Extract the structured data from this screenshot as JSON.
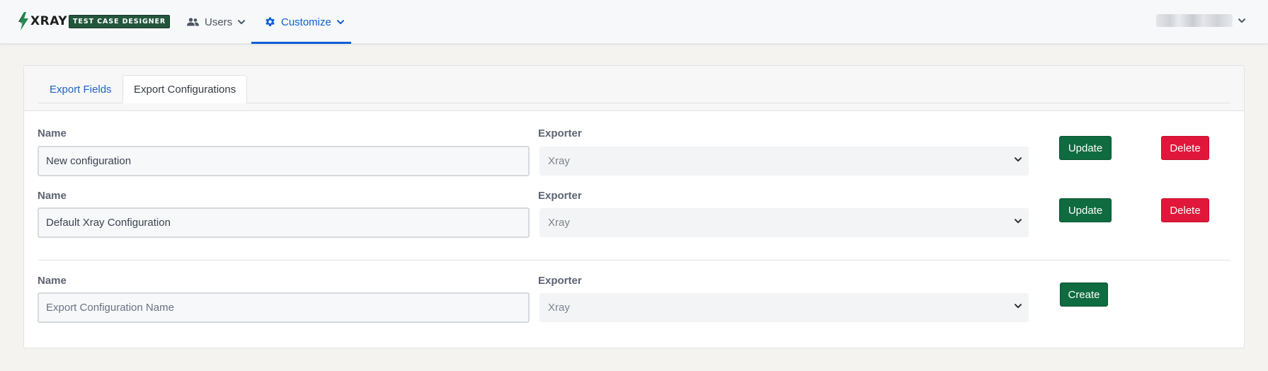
{
  "header": {
    "logo": {
      "wordmark": "XRAY",
      "badge": "TEST CASE DESIGNER",
      "icon": "lightning-bolt-icon"
    },
    "nav": [
      {
        "label": "Users",
        "icon": "users-icon",
        "active": false
      },
      {
        "label": "Customize",
        "icon": "gear-icon",
        "active": true
      }
    ],
    "user_menu": {
      "icon": "chevron-down-icon"
    }
  },
  "tabs": [
    {
      "label": "Export Fields",
      "active": false
    },
    {
      "label": "Export Configurations",
      "active": true
    }
  ],
  "configurations": [
    {
      "name_label": "Name",
      "name_value": "New configuration",
      "exporter_label": "Exporter",
      "exporter_value": "Xray",
      "update_label": "Update",
      "delete_label": "Delete"
    },
    {
      "name_label": "Name",
      "name_value": "Default Xray Configuration",
      "exporter_label": "Exporter",
      "exporter_value": "Xray",
      "update_label": "Update",
      "delete_label": "Delete"
    }
  ],
  "new_configuration": {
    "name_label": "Name",
    "name_placeholder": "Export Configuration Name",
    "exporter_label": "Exporter",
    "exporter_value": "Xray",
    "create_label": "Create"
  },
  "colors": {
    "accent": "#0d5fd6",
    "primary_button": "#0f6b40",
    "danger_button": "#e0173a",
    "logo_badge": "#23563c"
  }
}
